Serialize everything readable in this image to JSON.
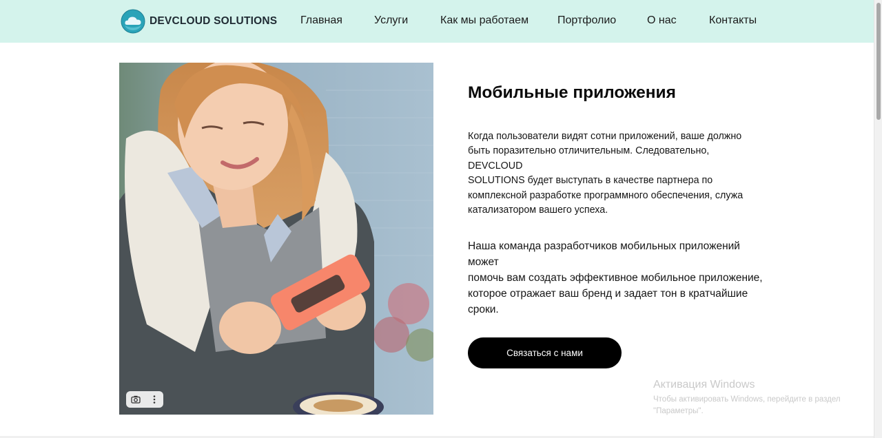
{
  "brand": {
    "name": "DEVCLOUD SOLUTIONS",
    "logo_icon": "cloud-logo-icon",
    "colors": {
      "header_bg": "#d4f3ec",
      "logo_teal": "#2aa3b8",
      "button_bg": "#000000"
    }
  },
  "nav": {
    "items": [
      {
        "label": "Главная"
      },
      {
        "label": "Услуги"
      },
      {
        "label": "Как мы работаем"
      },
      {
        "label": "Портфолио"
      },
      {
        "label": "О нас"
      },
      {
        "label": "Контакты"
      }
    ]
  },
  "hero": {
    "image_tools": {
      "camera_icon": "camera-icon",
      "more_icon": "more-vertical-icon"
    },
    "title": "Мобильные приложения",
    "paragraph1_lines": [
      "Когда пользователи видят сотни приложений, ваше должно",
      "быть поразительно отличительным. Следовательно,",
      "DEVCLOUD",
      "SOLUTIONS будет выступать в качестве партнера по",
      "комплексной разработке программного обеспечения, служа",
      "катализатором вашего успеха."
    ],
    "paragraph2_lines": [
      "Наша команда разработчиков мобильных приложений",
      "может",
      "помочь вам создать эффективное мобильное приложение,",
      "которое отражает ваш бренд и задает тон в кратчайшие",
      "сроки."
    ],
    "cta_label": "Связаться с нами"
  },
  "windows_watermark": {
    "title": "Активация Windows",
    "line1": "Чтобы активировать Windows, перейдите в раздел",
    "line2": "\"Параметры\"."
  }
}
